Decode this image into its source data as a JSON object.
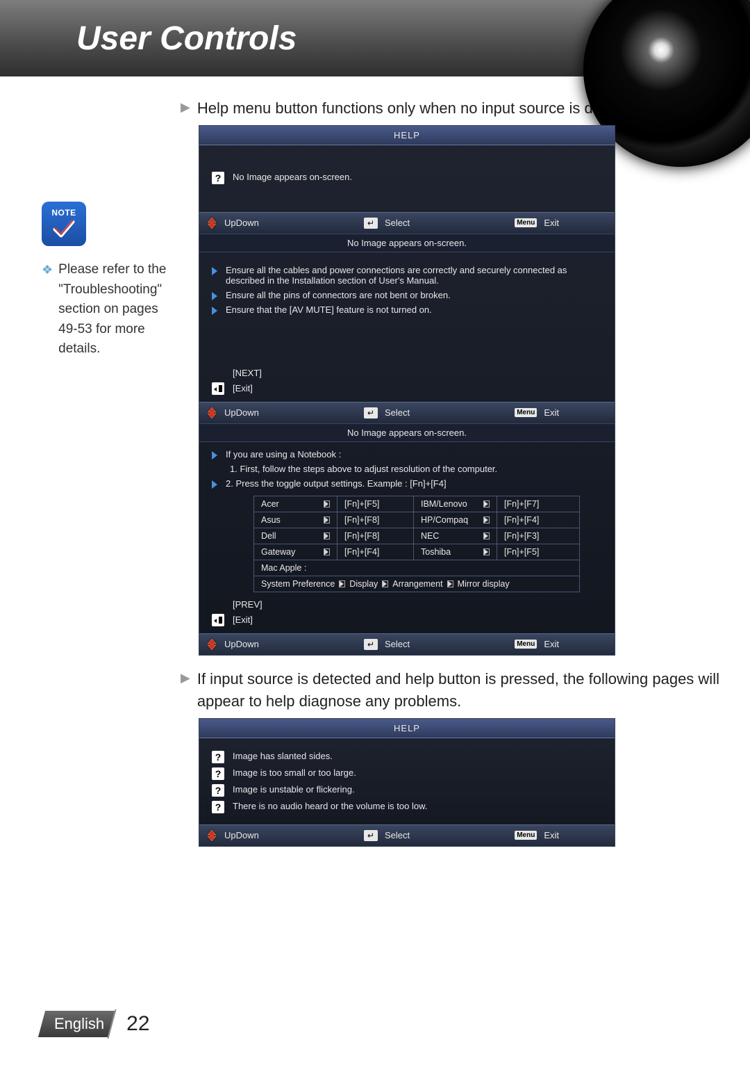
{
  "header": {
    "title": "User Controls"
  },
  "sidebar": {
    "note_label": "NOTE",
    "note_text": "Please refer to the \"Troubleshooting\" section on pages 49-53 for more details."
  },
  "para1": "Help menu button functions only when no input source is detected.",
  "para2": "If input source is detected and help button is pressed, the following pages will appear to help diagnose any problems.",
  "footer_labels": {
    "updown": "UpDown",
    "select": "Select",
    "exit": "Exit",
    "menu": "Menu"
  },
  "osd1": {
    "title": "HELP",
    "item": "No Image appears on-screen."
  },
  "osd2": {
    "section_title": "No Image appears on-screen.",
    "bullets": [
      "Ensure all the cables and power connections are correctly and securely connected as described in the Installation section of User's Manual.",
      "Ensure all the pins of connectors are not bent or broken.",
      "Ensure that the [AV MUTE] feature is not turned on."
    ],
    "next": "[NEXT]",
    "exit": "[Exit]"
  },
  "osd3": {
    "section_title": "No Image appears on-screen.",
    "line1": "If you are using a Notebook :",
    "sub1": "1. First, follow the steps above to adjust resolution of the computer.",
    "line2": "2. Press the toggle output settings. Example : [Fn]+[F4]",
    "brands": {
      "left": [
        {
          "name": "Acer",
          "key": "[Fn]+[F5]"
        },
        {
          "name": "Asus",
          "key": "[Fn]+[F8]"
        },
        {
          "name": "Dell",
          "key": "[Fn]+[F8]"
        },
        {
          "name": "Gateway",
          "key": "[Fn]+[F4]"
        }
      ],
      "right": [
        {
          "name": "IBM/Lenovo",
          "key": "[Fn]+[F7]"
        },
        {
          "name": "HP/Compaq",
          "key": "[Fn]+[F4]"
        },
        {
          "name": "NEC",
          "key": "[Fn]+[F3]"
        },
        {
          "name": "Toshiba",
          "key": "[Fn]+[F5]"
        }
      ],
      "mac_label": "Mac Apple :",
      "mac_path": [
        "System Preference",
        "Display",
        "Arrangement",
        "Mirror display"
      ]
    },
    "prev": "[PREV]",
    "exit": "[Exit]"
  },
  "osd4": {
    "title": "HELP",
    "items": [
      "Image has slanted sides.",
      "Image is too small or too large.",
      "Image is unstable or flickering.",
      "There is no audio heard or the volume is too low."
    ]
  },
  "pagefoot": {
    "lang": "English",
    "num": "22"
  }
}
